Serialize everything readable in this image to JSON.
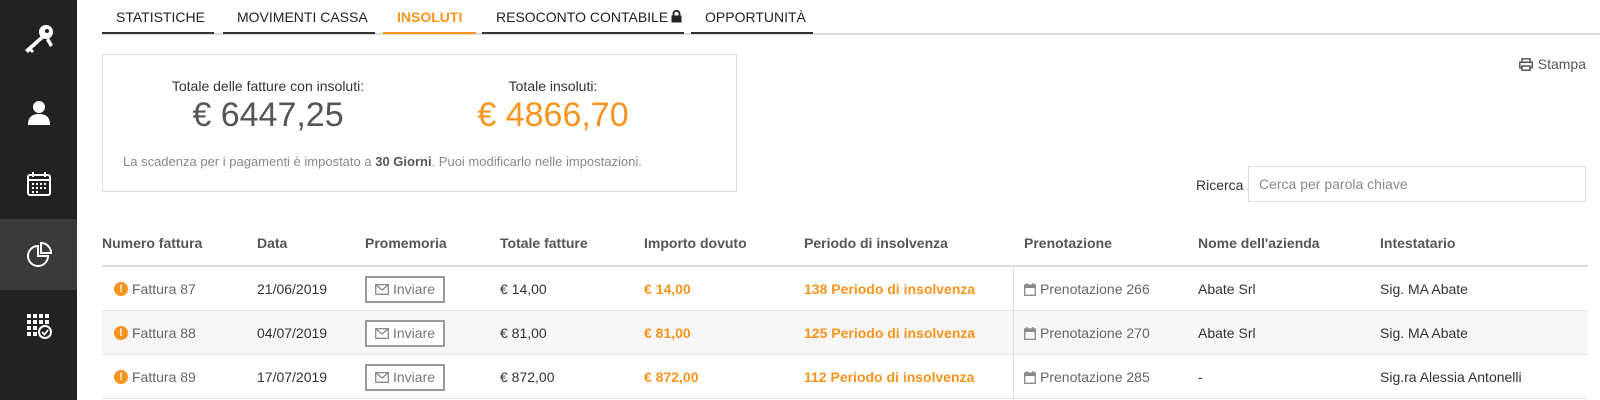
{
  "tabs": [
    {
      "label": "STATISTICHE",
      "active": false
    },
    {
      "label": "MOVIMENTI CASSA",
      "active": false
    },
    {
      "label": "INSOLUTI",
      "active": true
    },
    {
      "label": "RESOCONTO CONTABILE",
      "active": false,
      "icon": "lock-icon"
    },
    {
      "label": "OPPORTUNITÀ",
      "active": false
    }
  ],
  "sidebar": {
    "items": [
      {
        "icon": "keys-icon",
        "active": false
      },
      {
        "icon": "user-icon",
        "active": false
      },
      {
        "icon": "calendar-icon",
        "active": false
      },
      {
        "icon": "pie-chart-icon",
        "active": true
      },
      {
        "icon": "calendar-check-icon",
        "active": false
      }
    ]
  },
  "summary": {
    "total_invoices_label": "Totale delle fatture con insoluti:",
    "total_invoices_value": "€ 6447,25",
    "total_unpaid_label": "Totale insoluti:",
    "total_unpaid_value": "€ 4866,70",
    "note_prefix": "La scadenza per i pagamenti è impostato a ",
    "note_bold": "30 Giorni",
    "note_suffix": ". Puoi modificarlo nelle impostazioni."
  },
  "print": {
    "label": "Stampa",
    "icon": "printer-icon"
  },
  "search": {
    "label": "Ricerca",
    "placeholder": "Cerca per parola chiave"
  },
  "table": {
    "headers": [
      "Numero fattura",
      "Data",
      "Promemoria",
      "Totale fatture",
      "Importo dovuto",
      "Periodo di insolvenza",
      "Prenotazione",
      "Nome dell'azienda",
      "Intestatario"
    ],
    "rows": [
      {
        "invoice": "Fattura 87",
        "date": "21/06/2019",
        "reminder": "Inviare",
        "total": "€ 14,00",
        "due": "€ 14,00",
        "period": "138 Periodo di insolvenza",
        "booking": "Prenotazione 266",
        "company": "Abate Srl",
        "holder": "Sig. MA Abate"
      },
      {
        "invoice": "Fattura 88",
        "date": "04/07/2019",
        "reminder": "Inviare",
        "total": "€ 81,00",
        "due": "€ 81,00",
        "period": "125 Periodo di insolvenza",
        "booking": "Prenotazione 270",
        "company": "Abate Srl",
        "holder": "Sig. MA Abate"
      },
      {
        "invoice": "Fattura 89",
        "date": "17/07/2019",
        "reminder": "Inviare",
        "total": "€ 872,00",
        "due": "€ 872,00",
        "period": "112 Periodo di insolvenza",
        "booking": "Prenotazione 285",
        "company": "-",
        "holder": "Sig.ra Alessia Antonelli"
      }
    ]
  },
  "colors": {
    "accent": "#f7941d",
    "sidebar_bg": "#222222",
    "sidebar_active": "#3a3a3a"
  }
}
